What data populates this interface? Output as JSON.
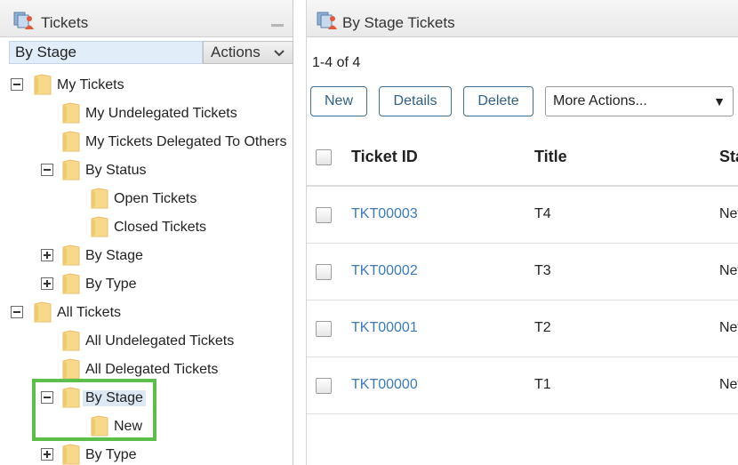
{
  "left_panel": {
    "title": "Tickets",
    "icon": "tickets-icon",
    "selector_value": "By Stage",
    "actions_label": "Actions",
    "tree": [
      {
        "label": "My Tickets",
        "toggle": "minus"
      },
      {
        "label": "My Undelegated Tickets"
      },
      {
        "label": "My Tickets Delegated To Others"
      },
      {
        "label": "By Status",
        "toggle": "minus"
      },
      {
        "label": "Open Tickets"
      },
      {
        "label": "Closed Tickets"
      },
      {
        "label": "By Stage",
        "toggle": "plus"
      },
      {
        "label": "By Type",
        "toggle": "plus"
      },
      {
        "label": "All Tickets",
        "toggle": "minus"
      },
      {
        "label": "All Undelegated Tickets"
      },
      {
        "label": "All Delegated Tickets"
      },
      {
        "label": "By Stage",
        "toggle": "minus",
        "selected": true
      },
      {
        "label": "New"
      },
      {
        "label": "By Type",
        "toggle": "plus"
      }
    ]
  },
  "right_panel": {
    "title": "By Stage Tickets",
    "count": "1-4 of 4",
    "buttons": {
      "new": "New",
      "details": "Details",
      "delete": "Delete"
    },
    "more_actions": "More Actions...",
    "columns": [
      "Ticket ID",
      "Title",
      "Status"
    ],
    "rows": [
      {
        "id": "TKT00003",
        "title": "T4",
        "status": "New"
      },
      {
        "id": "TKT00002",
        "title": "T3",
        "status": "New"
      },
      {
        "id": "TKT00001",
        "title": "T2",
        "status": "New"
      },
      {
        "id": "TKT00000",
        "title": "T1",
        "status": "New"
      }
    ]
  },
  "colors": {
    "link": "#3a7ab8",
    "highlight": "#5bbf4a",
    "folder": "#f7d98a",
    "button_border": "#3e6f93"
  }
}
